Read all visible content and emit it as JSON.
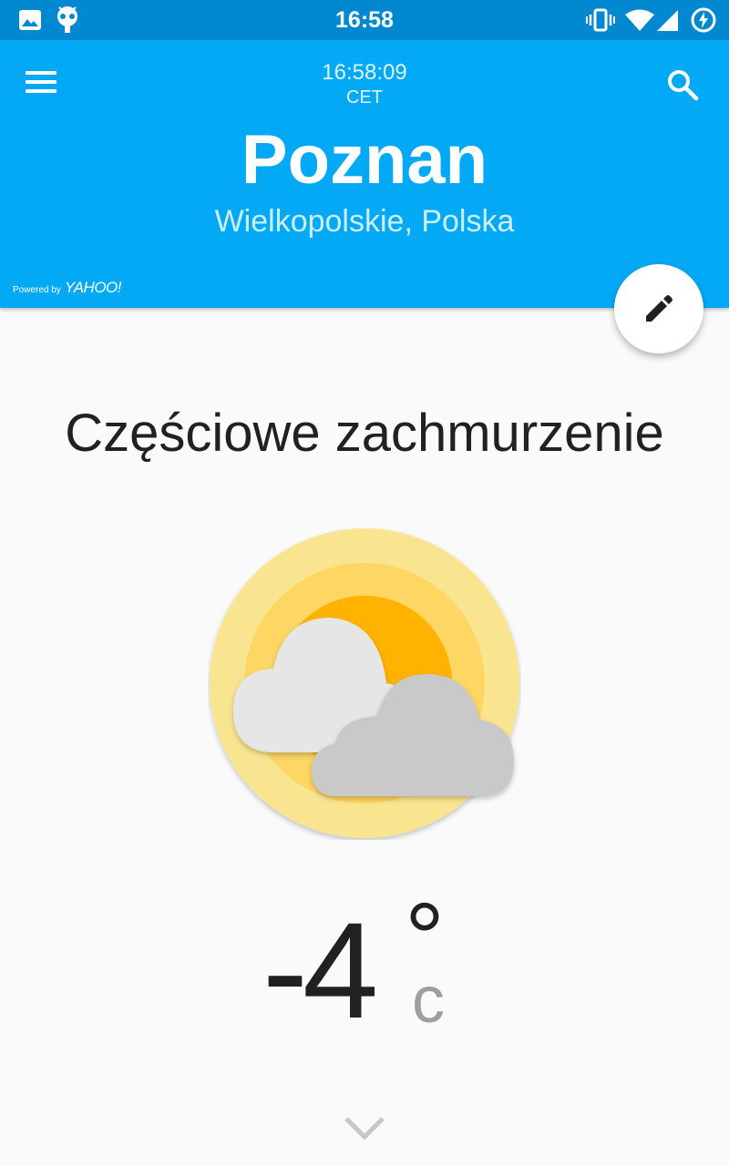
{
  "status_bar": {
    "time": "16:58",
    "left_icons": [
      "image-icon",
      "android-icon"
    ],
    "right_icons": [
      "vibrate-icon",
      "wifi-icon",
      "signal-icon",
      "battery-charging-icon"
    ],
    "background": "#0288d1"
  },
  "header": {
    "clock": "16:58:09",
    "timezone": "CET",
    "city": "Poznan",
    "region": "Wielkopolskie, Polska",
    "powered_by": "Powered by",
    "provider": "YAHOO!",
    "background": "#03a9f4"
  },
  "main": {
    "condition": "Częściowe zachmurzenie",
    "icon": "partly-cloudy-icon",
    "temperature": "-4",
    "degree_symbol": "°",
    "unit": "c"
  }
}
